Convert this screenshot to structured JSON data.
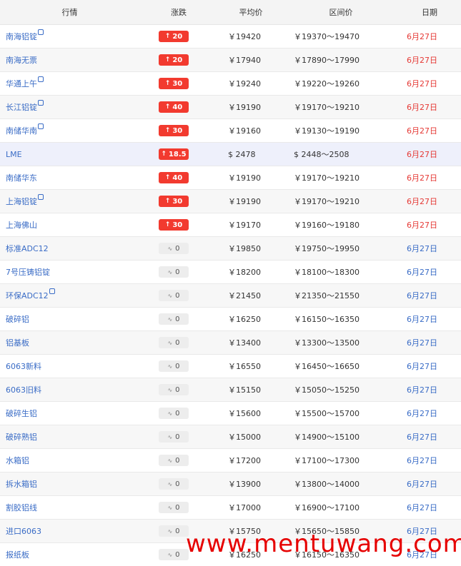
{
  "headers": {
    "name": "行情",
    "change": "涨跌",
    "avg": "平均价",
    "range": "区间价",
    "date": "日期"
  },
  "rows": [
    {
      "name": "南海铝锭",
      "mark": true,
      "change": "20",
      "dir": "up",
      "avg": "￥19420",
      "range": "￥19370～19470",
      "date": "6月27日",
      "date_color": "red"
    },
    {
      "name": "南海无票",
      "mark": false,
      "change": "20",
      "dir": "up",
      "avg": "￥17940",
      "range": "￥17890～17990",
      "date": "6月27日",
      "date_color": "red"
    },
    {
      "name": "华通上午",
      "mark": true,
      "change": "30",
      "dir": "up",
      "avg": "￥19240",
      "range": "￥19220～19260",
      "date": "6月27日",
      "date_color": "red"
    },
    {
      "name": "长江铝锭",
      "mark": true,
      "change": "40",
      "dir": "up",
      "avg": "￥19190",
      "range": "￥19170～19210",
      "date": "6月27日",
      "date_color": "red"
    },
    {
      "name": "南储华南",
      "mark": true,
      "change": "30",
      "dir": "up",
      "avg": "￥19160",
      "range": "￥19130～19190",
      "date": "6月27日",
      "date_color": "red"
    },
    {
      "name": "LME",
      "mark": false,
      "change": "18.5",
      "dir": "up",
      "avg": "$ 2478",
      "range": "$ 2448～2508",
      "date": "6月27日",
      "date_color": "red"
    },
    {
      "name": "南储华东",
      "mark": false,
      "change": "40",
      "dir": "up",
      "avg": "￥19190",
      "range": "￥19170～19210",
      "date": "6月27日",
      "date_color": "red"
    },
    {
      "name": "上海铝锭",
      "mark": true,
      "change": "30",
      "dir": "up",
      "avg": "￥19190",
      "range": "￥19170～19210",
      "date": "6月27日",
      "date_color": "red"
    },
    {
      "name": "上海佛山",
      "mark": false,
      "change": "30",
      "dir": "up",
      "avg": "￥19170",
      "range": "￥19160～19180",
      "date": "6月27日",
      "date_color": "red"
    },
    {
      "name": "标准ADC12",
      "mark": false,
      "change": "0",
      "dir": "flat",
      "avg": "￥19850",
      "range": "￥19750～19950",
      "date": "6月27日",
      "date_color": "blue"
    },
    {
      "name": "7号压铸铝锭",
      "mark": false,
      "change": "0",
      "dir": "flat",
      "avg": "￥18200",
      "range": "￥18100～18300",
      "date": "6月27日",
      "date_color": "blue"
    },
    {
      "name": "环保ADC12",
      "mark": true,
      "change": "0",
      "dir": "flat",
      "avg": "￥21450",
      "range": "￥21350～21550",
      "date": "6月27日",
      "date_color": "blue"
    },
    {
      "name": "破碎铝",
      "mark": false,
      "change": "0",
      "dir": "flat",
      "avg": "￥16250",
      "range": "￥16150～16350",
      "date": "6月27日",
      "date_color": "blue"
    },
    {
      "name": "铝基板",
      "mark": false,
      "change": "0",
      "dir": "flat",
      "avg": "￥13400",
      "range": "￥13300～13500",
      "date": "6月27日",
      "date_color": "blue"
    },
    {
      "name": "6063新料",
      "mark": false,
      "change": "0",
      "dir": "flat",
      "avg": "￥16550",
      "range": "￥16450～16650",
      "date": "6月27日",
      "date_color": "blue"
    },
    {
      "name": "6063旧料",
      "mark": false,
      "change": "0",
      "dir": "flat",
      "avg": "￥15150",
      "range": "￥15050～15250",
      "date": "6月27日",
      "date_color": "blue"
    },
    {
      "name": "破碎生铝",
      "mark": false,
      "change": "0",
      "dir": "flat",
      "avg": "￥15600",
      "range": "￥15500～15700",
      "date": "6月27日",
      "date_color": "blue"
    },
    {
      "name": "破碎熟铝",
      "mark": false,
      "change": "0",
      "dir": "flat",
      "avg": "￥15000",
      "range": "￥14900～15100",
      "date": "6月27日",
      "date_color": "blue"
    },
    {
      "name": "水箱铝",
      "mark": false,
      "change": "0",
      "dir": "flat",
      "avg": "￥17200",
      "range": "￥17100～17300",
      "date": "6月27日",
      "date_color": "blue"
    },
    {
      "name": "拆水箱铝",
      "mark": false,
      "change": "0",
      "dir": "flat",
      "avg": "￥13900",
      "range": "￥13800～14000",
      "date": "6月27日",
      "date_color": "blue"
    },
    {
      "name": "割胶铝线",
      "mark": false,
      "change": "0",
      "dir": "flat",
      "avg": "￥17000",
      "range": "￥16900～17100",
      "date": "6月27日",
      "date_color": "blue"
    },
    {
      "name": "进口6063",
      "mark": false,
      "change": "0",
      "dir": "flat",
      "avg": "￥15750",
      "range": "￥15650～15850",
      "date": "6月27日",
      "date_color": "blue"
    },
    {
      "name": "报纸板",
      "mark": false,
      "change": "0",
      "dir": "flat",
      "avg": "￥16250",
      "range": "￥16150～16350",
      "date": "6月27日",
      "date_color": "blue"
    }
  ],
  "highlight_row_index": 5,
  "colors": {
    "up_badge": "#f23a2f",
    "flat_badge": "#ededed",
    "link": "#3a6cc6",
    "date_red": "#e53935",
    "date_blue": "#3a6cc6",
    "watermark": "#e60000"
  },
  "watermark": "www.mentuwang.com"
}
